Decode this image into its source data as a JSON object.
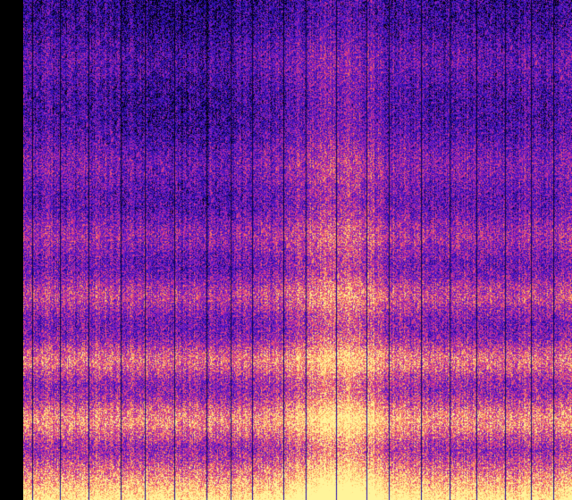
{
  "image": {
    "kind": "spectrogram",
    "colormap": [
      "#000000",
      "#1a0a8c",
      "#3a14c8",
      "#7a1ec0",
      "#c02aa0",
      "#f05a6a",
      "#ffb060",
      "#fff49a"
    ],
    "background": "#000000",
    "features": {
      "horizontal_bands": 6,
      "vertical_streaks": true,
      "bright_floor": true,
      "central_bright_column": true
    }
  }
}
